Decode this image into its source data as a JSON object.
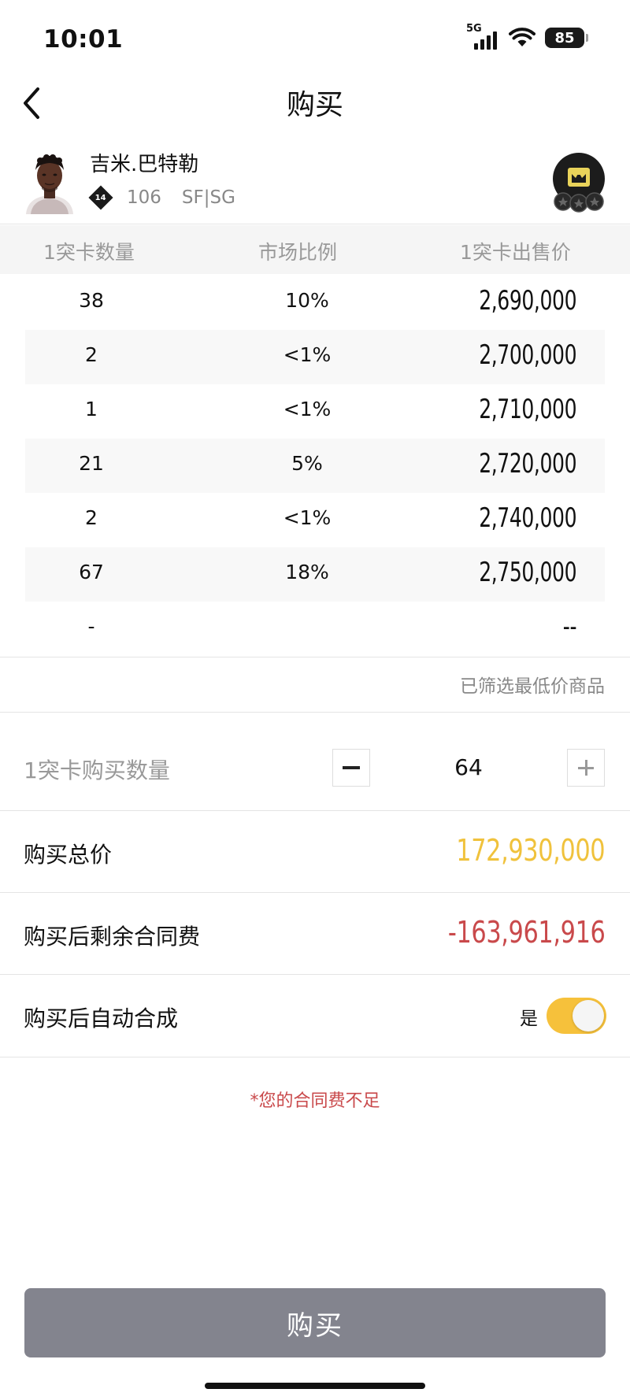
{
  "status_bar": {
    "time": "10:01",
    "network": "5G",
    "battery": "85"
  },
  "nav": {
    "title": "购买",
    "back_icon": "chevron-left-icon"
  },
  "player": {
    "name": "吉米.巴特勒",
    "rank": "14",
    "ovr": "106",
    "position": "SF|SG",
    "badge_icon": "crown-badge-icon"
  },
  "table": {
    "headers": [
      "1突卡数量",
      "市场比例",
      "1突卡出售价"
    ],
    "rows": [
      {
        "qty": "38",
        "ratio": "10%",
        "price": "2,690,000"
      },
      {
        "qty": "2",
        "ratio": "<1%",
        "price": "2,700,000"
      },
      {
        "qty": "1",
        "ratio": "<1%",
        "price": "2,710,000"
      },
      {
        "qty": "21",
        "ratio": "5%",
        "price": "2,720,000"
      },
      {
        "qty": "2",
        "ratio": "<1%",
        "price": "2,740,000"
      },
      {
        "qty": "67",
        "ratio": "18%",
        "price": "2,750,000"
      },
      {
        "qty": "-",
        "ratio": "",
        "price": "--"
      }
    ],
    "filter_note": "已筛选最低价商品"
  },
  "purchase": {
    "qty_label": "1突卡购买数量",
    "qty_value": "64",
    "total_label": "购买总价",
    "total_value": "172,930,000",
    "remaining_label": "购买后剩余合同费",
    "remaining_value": "-163,961,916",
    "auto_merge_label": "购买后自动合成",
    "auto_merge_state": "是",
    "auto_merge_on": true,
    "warning": "*您的合同费不足",
    "buy_button": "购买"
  },
  "colors": {
    "accent_yellow": "#f6c13b",
    "total_color": "#f0c23c",
    "warning_red": "#c9494b",
    "button_gray": "#83848e"
  }
}
